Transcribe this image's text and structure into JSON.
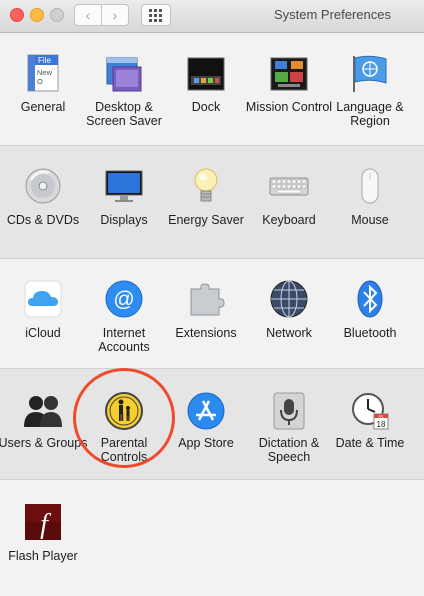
{
  "window": {
    "title": "System Preferences",
    "back_glyph": "‹",
    "forward_glyph": "›"
  },
  "rows": [
    {
      "panes": [
        {
          "label": "General",
          "icon": "general-icon"
        },
        {
          "label": "Desktop & Screen Saver",
          "icon": "desktop-icon"
        },
        {
          "label": "Dock",
          "icon": "dock-icon"
        },
        {
          "label": "Mission Control",
          "icon": "mission-control-icon"
        },
        {
          "label": "Language & Region",
          "icon": "language-region-icon"
        }
      ]
    },
    {
      "panes": [
        {
          "label": "CDs & DVDs",
          "icon": "cd-icon"
        },
        {
          "label": "Displays",
          "icon": "display-icon"
        },
        {
          "label": "Energy Saver",
          "icon": "lightbulb-icon"
        },
        {
          "label": "Keyboard",
          "icon": "keyboard-icon"
        },
        {
          "label": "Mouse",
          "icon": "mouse-icon"
        }
      ]
    },
    {
      "panes": [
        {
          "label": "iCloud",
          "icon": "icloud-icon"
        },
        {
          "label": "Internet Accounts",
          "icon": "at-icon"
        },
        {
          "label": "Extensions",
          "icon": "puzzle-icon"
        },
        {
          "label": "Network",
          "icon": "globe-icon"
        },
        {
          "label": "Bluetooth",
          "icon": "bluetooth-icon"
        }
      ]
    },
    {
      "panes": [
        {
          "label": "Users & Groups",
          "icon": "users-icon"
        },
        {
          "label": "Parental Controls",
          "icon": "parental-icon"
        },
        {
          "label": "App Store",
          "icon": "app-store-icon"
        },
        {
          "label": "Dictation & Speech",
          "icon": "microphone-icon"
        },
        {
          "label": "Date & Time",
          "icon": "clock-icon"
        }
      ]
    },
    {
      "panes": [
        {
          "label": "Flash Player",
          "icon": "flash-icon"
        }
      ]
    }
  ],
  "icon_text": {
    "general_file": "File",
    "general_new": "New",
    "general_o": "O",
    "at_symbol": "@",
    "bluetooth_symbol": "ᛒ",
    "flash_symbol": "f",
    "calendar_month": "JUL",
    "calendar_day": "18"
  },
  "annotation": {
    "color": "#ee4a2e"
  }
}
